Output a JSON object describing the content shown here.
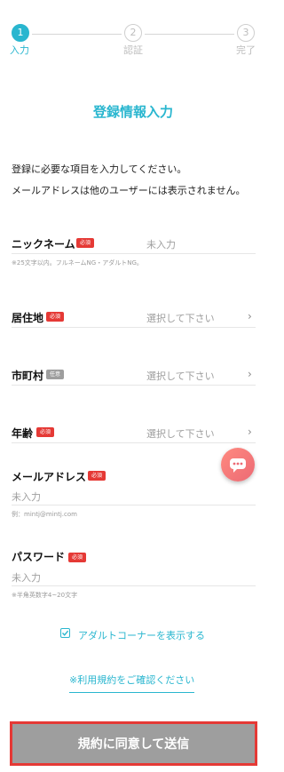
{
  "steps": [
    {
      "number": "1",
      "label": "入力"
    },
    {
      "number": "2",
      "label": "認証"
    },
    {
      "number": "3",
      "label": "完了"
    }
  ],
  "title": "登録情報入力",
  "intro": {
    "line1": "登録に必要な項目を入力してください。",
    "line2": "メールアドレスは他のユーザーには表示されません。"
  },
  "fields": {
    "nickname": {
      "label": "ニックネーム",
      "badge": "必須",
      "value": "未入力",
      "note": "※25文字以内。フルネームNG・アダルトNG。"
    },
    "residence": {
      "label": "居住地",
      "badge": "必須",
      "value": "選択して下さい"
    },
    "city": {
      "label": "市町村",
      "badge": "任意",
      "value": "選択して下さい"
    },
    "age": {
      "label": "年齢",
      "badge": "必須",
      "value": "選択して下さい"
    },
    "email": {
      "label": "メールアドレス",
      "badge": "必須",
      "value": "未入力",
      "note": "例：mintj@mintj.com"
    },
    "password": {
      "label": "パスワード",
      "badge": "必須",
      "value": "未入力",
      "note": "※半角英数字4~20文字"
    }
  },
  "adult_corner": {
    "label": "アダルトコーナーを表示する",
    "checked": true
  },
  "terms_link": "※利用規約をご確認ください",
  "submit_label": "規約に同意して送信",
  "colors": {
    "accent": "#29b6cf",
    "required": "#e53935",
    "optional": "#9e9e9e"
  }
}
